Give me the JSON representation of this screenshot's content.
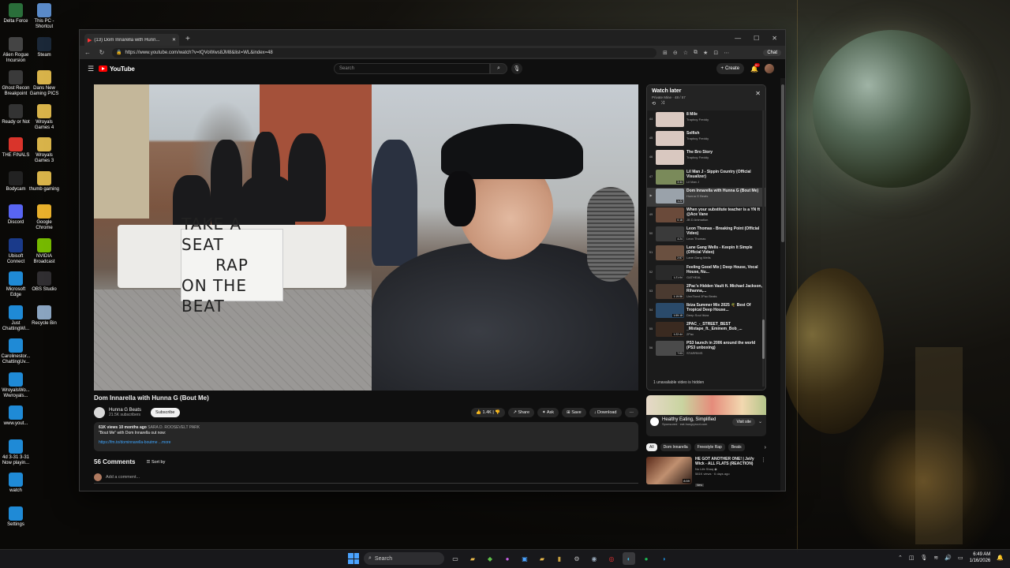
{
  "desktop": {
    "icons": [
      {
        "label": "Delta Force",
        "color": "#2a6e3a"
      },
      {
        "label": "This PC - Shortcut",
        "color": "#5a8ac8"
      },
      {
        "label": "Alien Rogue Incursion",
        "color": "#444"
      },
      {
        "label": "Steam",
        "color": "#1b2838"
      },
      {
        "label": "Ghost Recon Breakpoint",
        "color": "#3a3a3a"
      },
      {
        "label": "Dans New Gaming PICS",
        "color": "#d8b34a"
      },
      {
        "label": "Ready or Not",
        "color": "#333"
      },
      {
        "label": "Wroyals Games 4",
        "color": "#d8b34a"
      },
      {
        "label": "THE FINALS",
        "color": "#d9342b"
      },
      {
        "label": "Wroyals Games 3",
        "color": "#d8b34a"
      },
      {
        "label": "Bodycam",
        "color": "#222"
      },
      {
        "label": "thumb gaming",
        "color": "#d8b34a"
      },
      {
        "label": "Discord",
        "color": "#5865f2"
      },
      {
        "label": "Google Chrome",
        "color": "#e8b02c"
      },
      {
        "label": "Ubisoft Connect",
        "color": "#1a3a8a"
      },
      {
        "label": "NVIDIA Broadcast",
        "color": "#76b900"
      },
      {
        "label": "Microsoft Edge",
        "color": "#1f8ad6"
      },
      {
        "label": "OBS Studio",
        "color": "#302e31"
      },
      {
        "label": "Just ChattingWi...",
        "color": "#1f8ad6"
      },
      {
        "label": "Recycle Bin",
        "color": "#8aa4c0"
      },
      {
        "label": "Carolinestor... ChattingUv...",
        "color": "#1f8ad6"
      },
      {
        "label": "WroyalsWo... Wwroyals...",
        "color": "#1f8ad6"
      },
      {
        "label": "www.yout...",
        "color": "#1f8ad6"
      },
      {
        "label": "4d 3-31 3-31 Now playin...",
        "color": "#1f8ad6"
      },
      {
        "label": "watch",
        "color": "#1f8ad6"
      },
      {
        "label": "Settings",
        "color": "#1f8ad6"
      }
    ]
  },
  "browser": {
    "tab_title": "(13) Dom Innarella with Hunn...",
    "url": "https://www.youtube.com/watch?v=tQVoWws8JM8&list=WL&index=48",
    "copilot_label": "Chat",
    "new_tab": "+",
    "minimize": "—",
    "maximize": "☐",
    "close": "✕"
  },
  "youtube": {
    "logo_text": "YouTube",
    "search_placeholder": "Search",
    "create_label": "Create",
    "notif_count": "9+",
    "video": {
      "sign_lines": [
        "TAKE A SEAT",
        "RAP",
        "ON THE BEAT"
      ],
      "title": "Dom Innarella with Hunna G (Bout Me)",
      "channel": "Hunna G Beats",
      "subscribers": "21.5K subscribers",
      "subscribe": "Subscribe",
      "likes": "1.4K",
      "share": "Share",
      "ask": "Ask",
      "save": "Save",
      "download": "Download",
      "more": "⋯",
      "desc_views": "61K views  10 months ago",
      "desc_location": "SARA D. ROOSEVELT PARK",
      "desc_line": "\"Bout Me\" with Dom Innarella out now:",
      "desc_link": "https://fm.to/dominnarella-boutme  ...more"
    },
    "comments": {
      "count": "56 Comments",
      "sort": "Sort by",
      "add": "Add a comment..."
    },
    "playlist": {
      "title": "Watch later",
      "meta": "Private  Mine  ·  48 / 57",
      "close": "✕",
      "items": [
        {
          "idx": "44",
          "title": "8 Mile",
          "channel": "Trapboy Freddy",
          "color": "#d9c8c0",
          "dur": ""
        },
        {
          "idx": "45",
          "title": "Selfish",
          "channel": "Trapboy Freddy",
          "color": "#d9c8c0",
          "dur": ""
        },
        {
          "idx": "46",
          "title": "The Bro Story",
          "channel": "Trapboy Freddy",
          "color": "#d9c8c0",
          "dur": ""
        },
        {
          "idx": "47",
          "title": "Lil Man J - Sippin Country (Official Visualizer)",
          "channel": "Lil Man J",
          "color": "#7a8a5a",
          "dur": "3:44"
        },
        {
          "idx": "▶",
          "title": "Dom Innarella with Hunna G (Bout Me)",
          "channel": "Hunna G Beats",
          "color": "#9aa2aa",
          "dur": "1:22"
        },
        {
          "idx": "49",
          "title": "When your substitute teacher is a YN ft @Ace Vane",
          "channel": "JB D Animation",
          "color": "#6a4a3a",
          "dur": "0:18"
        },
        {
          "idx": "50",
          "title": "Leon Thomas - Breaking Point (Official Video)",
          "channel": "Leon Thomas",
          "color": "#3a3a3a",
          "dur": "4:24"
        },
        {
          "idx": "51",
          "title": "Lane Gang Wells - Keepin It Simple (Official Video)",
          "channel": "Lane Gang Wells",
          "color": "#6a5040",
          "dur": "2:57"
        },
        {
          "idx": "52",
          "title": "Feeling Good Mix | Deep House, Vocal House, Nu...",
          "channel": "GATHEAL",
          "color": "#2a2a2a",
          "dur": "1:21:04"
        },
        {
          "idx": "53",
          "title": "2Pac's Hidden Vault ft. Michael Jackson, Rihanna,...",
          "channel": "UnoTiced 2Pac Beats",
          "color": "#4a3a30",
          "dur": "1:19:56"
        },
        {
          "idx": "54",
          "title": "Ibiza Summer Mix 2025 🌴 Best Of Tropical Deep House...",
          "channel": "Deep Soul Ibiza",
          "color": "#2a4a6a",
          "dur": "1:59:18"
        },
        {
          "idx": "55",
          "title": "2PAC_-_STREET_BEST _Mixtape_ft._Eminem_Bob_...",
          "channel": "2Pac",
          "color": "#3a2a20",
          "dur": "1:22:44"
        },
        {
          "idx": "56",
          "title": "PS3 launch in 2006 around the world (PS3 unboxing)",
          "channel": "STARRIMS",
          "color": "#4a4a4a",
          "dur": "7:03"
        }
      ],
      "unavailable": "1 unavailable video is hidden"
    },
    "ad": {
      "title": "Healthy Eating, Simplified",
      "sub": "Sponsored · eat.hungryroot.com",
      "visit": "Visit site"
    },
    "chips": [
      "All",
      "Dom Innarella",
      "Freestyle Rap",
      "Beats"
    ],
    "recommended": {
      "title": "HE GOT ANOTHER ONE! | JaVy Wick - ALL FLATS (REACTION)",
      "channel": "No Life Shaq ◉",
      "meta": "581K views · 6 days ago",
      "badge": "New",
      "dur": "8:59"
    }
  },
  "taskbar": {
    "search": "Search",
    "time": "6:49 AM",
    "date": "1/16/2026"
  }
}
